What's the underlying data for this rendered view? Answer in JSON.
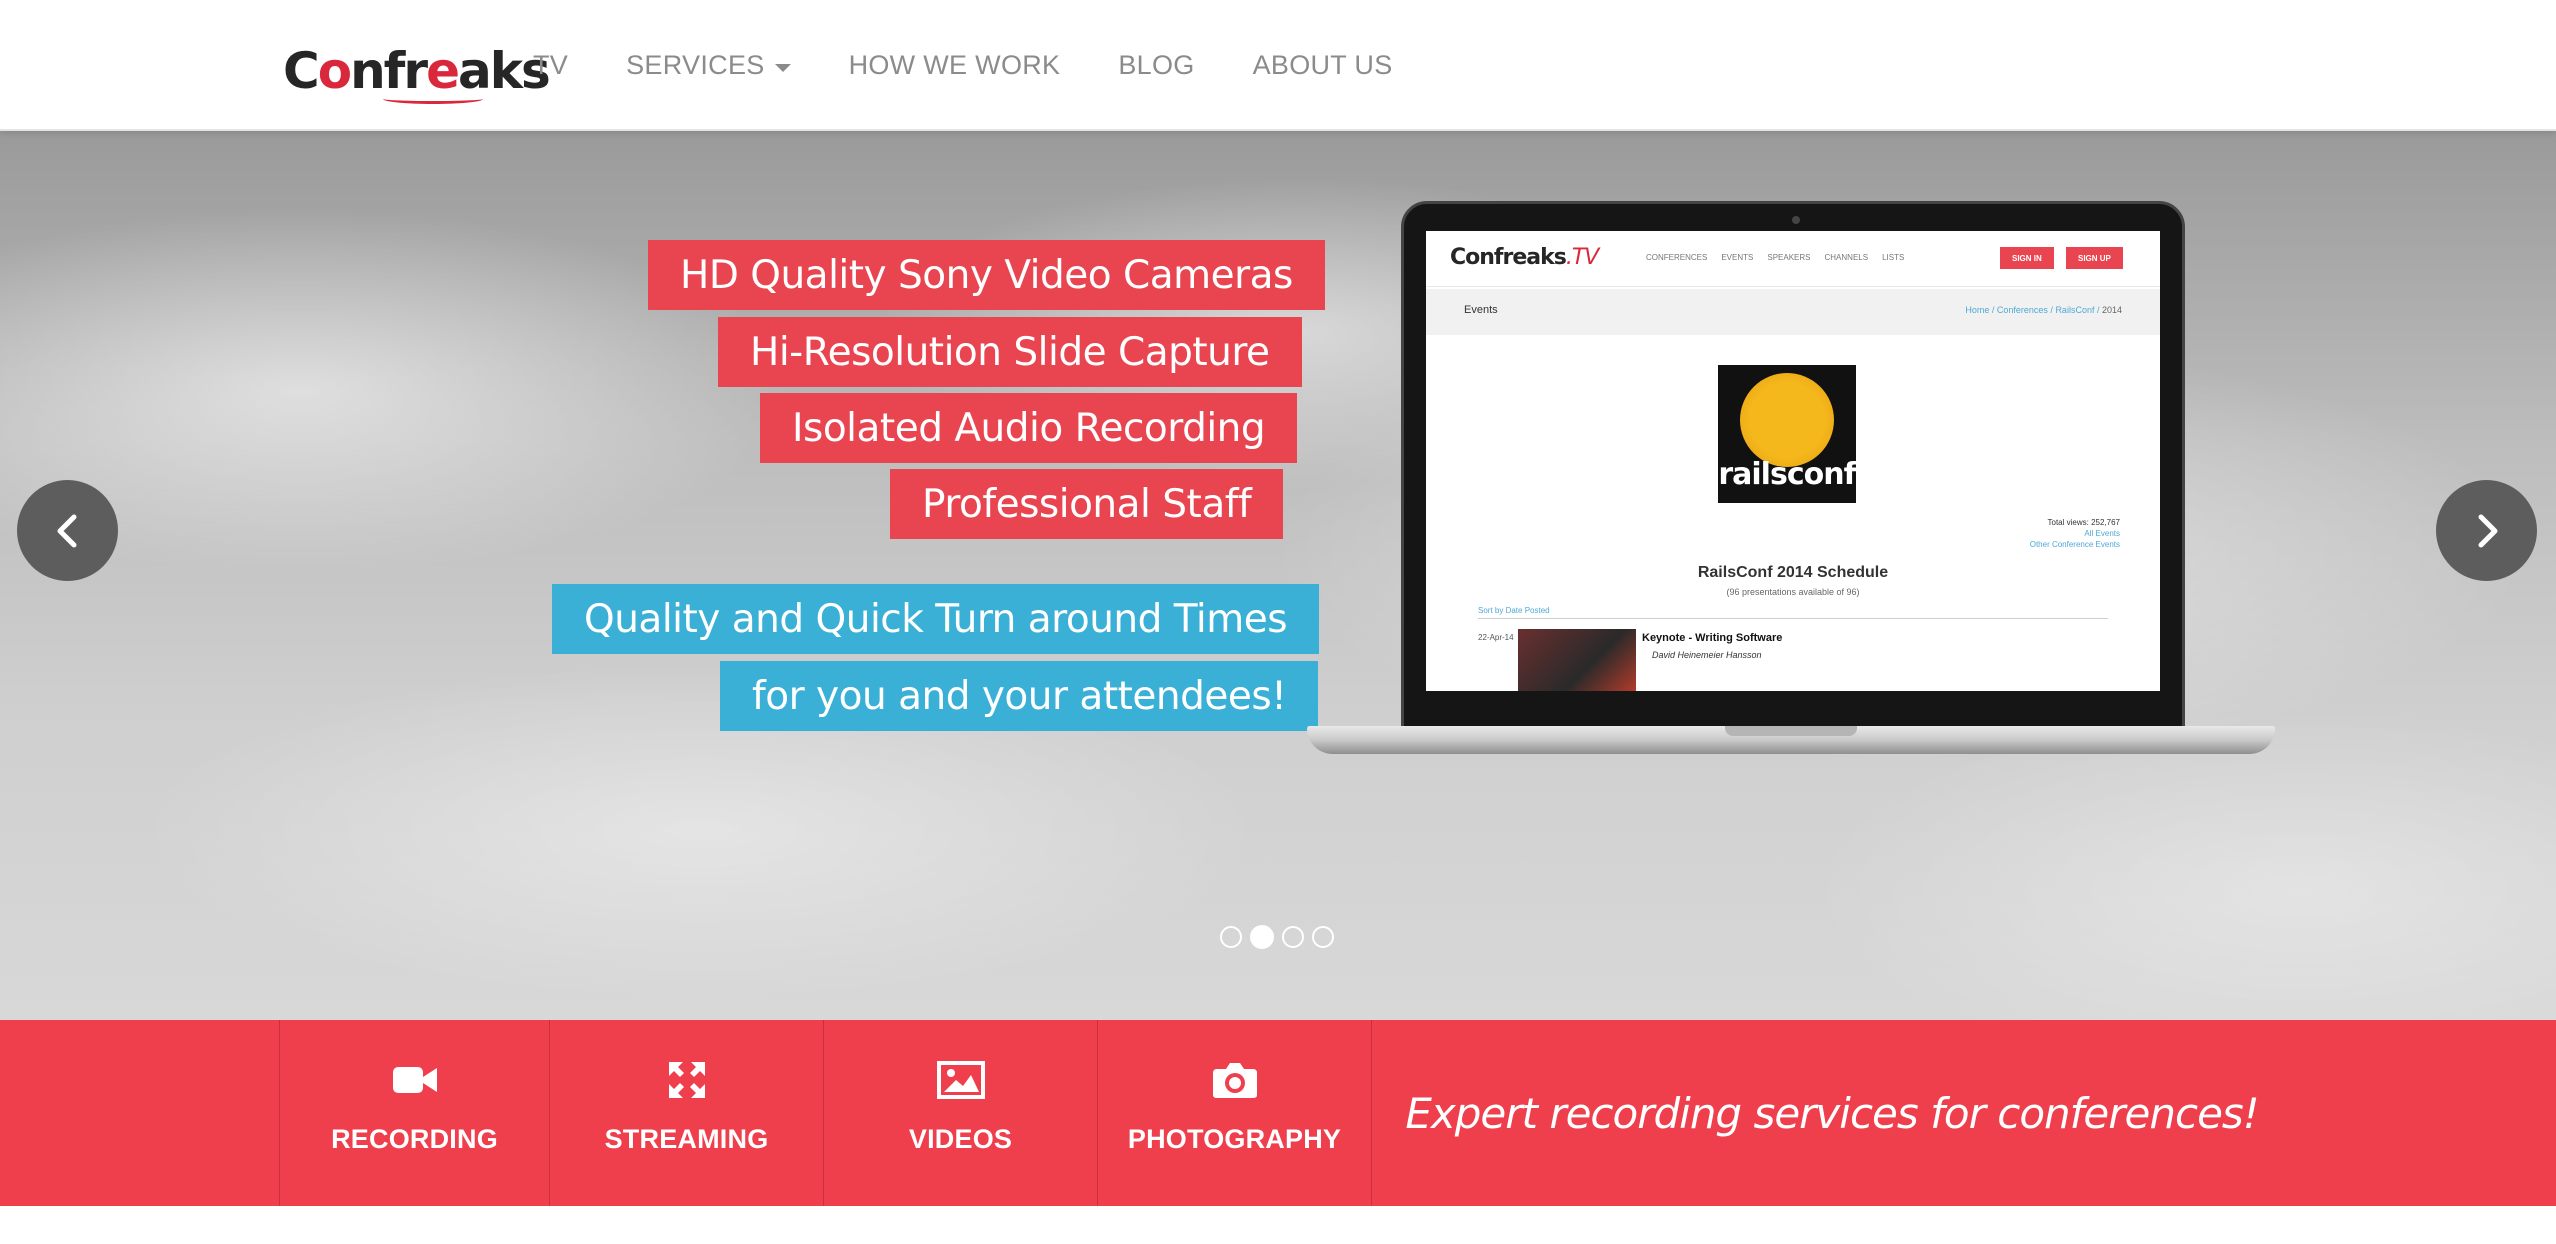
{
  "brand": {
    "logo_text_1": "C",
    "logo_text_2": "o",
    "logo_text_3": "nfr",
    "logo_text_4": "e",
    "logo_text_5": "aks"
  },
  "nav": {
    "items": [
      {
        "label": "TV"
      },
      {
        "label": "SERVICES"
      },
      {
        "label": "HOW WE WORK"
      },
      {
        "label": "BLOG"
      },
      {
        "label": "ABOUT US"
      }
    ]
  },
  "hero": {
    "features_red": [
      "HD Quality Sony Video Cameras",
      "Hi-Resolution Slide Capture",
      "Isolated Audio Recording",
      "Professional Staff"
    ],
    "features_blue": [
      "Quality and Quick Turn around Times",
      "for you and your attendees!"
    ],
    "slide_count": 4,
    "active_slide": 2
  },
  "laptop_screen": {
    "logo": "Confreaks",
    "logo_tv": ".TV",
    "nav_links": [
      "CONFERENCES",
      "EVENTS",
      "SPEAKERS",
      "CHANNELS",
      "LISTS"
    ],
    "sign_in": "SIGN IN",
    "sign_up": "SIGN UP",
    "section": "Events",
    "breadcrumb": [
      "Home",
      "Conferences",
      "RailsConf",
      "2014"
    ],
    "event_logo_text": "railsconf",
    "total_views": "Total views: 252,767",
    "all_events": "All Events",
    "other_events": "Other Conference Events",
    "schedule_title": "RailsConf 2014 Schedule",
    "schedule_sub": "(96 presentations available of 96)",
    "sort_label": "Sort by Date Posted",
    "video_date": "22-Apr-14",
    "video_title": "Keynote - Writing Software",
    "video_author": "David Heinemeier Hansson"
  },
  "services": {
    "items": [
      {
        "label": "RECORDING",
        "icon": "video-camera-icon"
      },
      {
        "label": "STREAMING",
        "icon": "arrows-expand-icon"
      },
      {
        "label": "VIDEOS",
        "icon": "picture-icon"
      },
      {
        "label": "PHOTOGRAPHY",
        "icon": "camera-icon"
      }
    ],
    "tagline": "Expert recording services for conferences!"
  },
  "colors": {
    "accent_red": "#ef3f4c",
    "tag_red": "#e94551",
    "tag_blue": "#3bb0d6",
    "nav_text": "#8b8b8b"
  }
}
